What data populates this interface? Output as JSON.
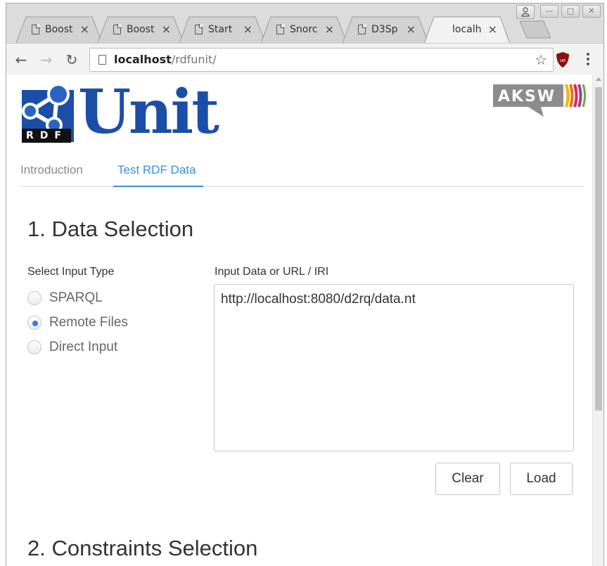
{
  "browser": {
    "tabs": [
      {
        "title": "Boost",
        "close": "×"
      },
      {
        "title": "Boost",
        "close": "×"
      },
      {
        "title": "Start",
        "close": "×"
      },
      {
        "title": "Snorc",
        "close": "×"
      },
      {
        "title": "D3Sp",
        "close": "×"
      },
      {
        "title": "localh",
        "close": "×",
        "active": true
      }
    ],
    "address": {
      "host": "localhost",
      "path": "/rdfunit/"
    },
    "icons": {
      "back": "back-arrow-icon",
      "forward": "forward-arrow-icon",
      "reload": "reload-icon",
      "page": "page-icon",
      "star": "bookmark-star-icon",
      "extension": "ublock-origin-icon",
      "menu": "kebab-menu-icon",
      "profile": "profile-icon"
    }
  },
  "header": {
    "logo": {
      "word": "Unit",
      "badge": "RDF"
    },
    "partner_logo": {
      "text": "AKSW",
      "stripe_colors": [
        "#f2b400",
        "#e8731e",
        "#d6285a",
        "#a23c92",
        "#5fb233"
      ]
    }
  },
  "nav": {
    "tabs": [
      {
        "label": "Introduction",
        "active": false
      },
      {
        "label": "Test RDF Data",
        "active": true
      }
    ]
  },
  "data_selection": {
    "title": "1. Data Selection",
    "input_type_label": "Select Input Type",
    "options": [
      {
        "label": "SPARQL",
        "checked": false
      },
      {
        "label": "Remote Files",
        "checked": true
      },
      {
        "label": "Direct Input",
        "checked": false
      }
    ],
    "input_label": "Input Data or URL / IRI",
    "input_value": "http://localhost:8080/d2rq/data.nt",
    "buttons": {
      "clear": "Clear",
      "load": "Load"
    }
  },
  "constraints_selection": {
    "title": "2. Constraints Selection"
  },
  "colors": {
    "accent": "#3b8ede",
    "logo_blue": "#1b4ea8",
    "radio_checked": "#3b7fd4"
  }
}
